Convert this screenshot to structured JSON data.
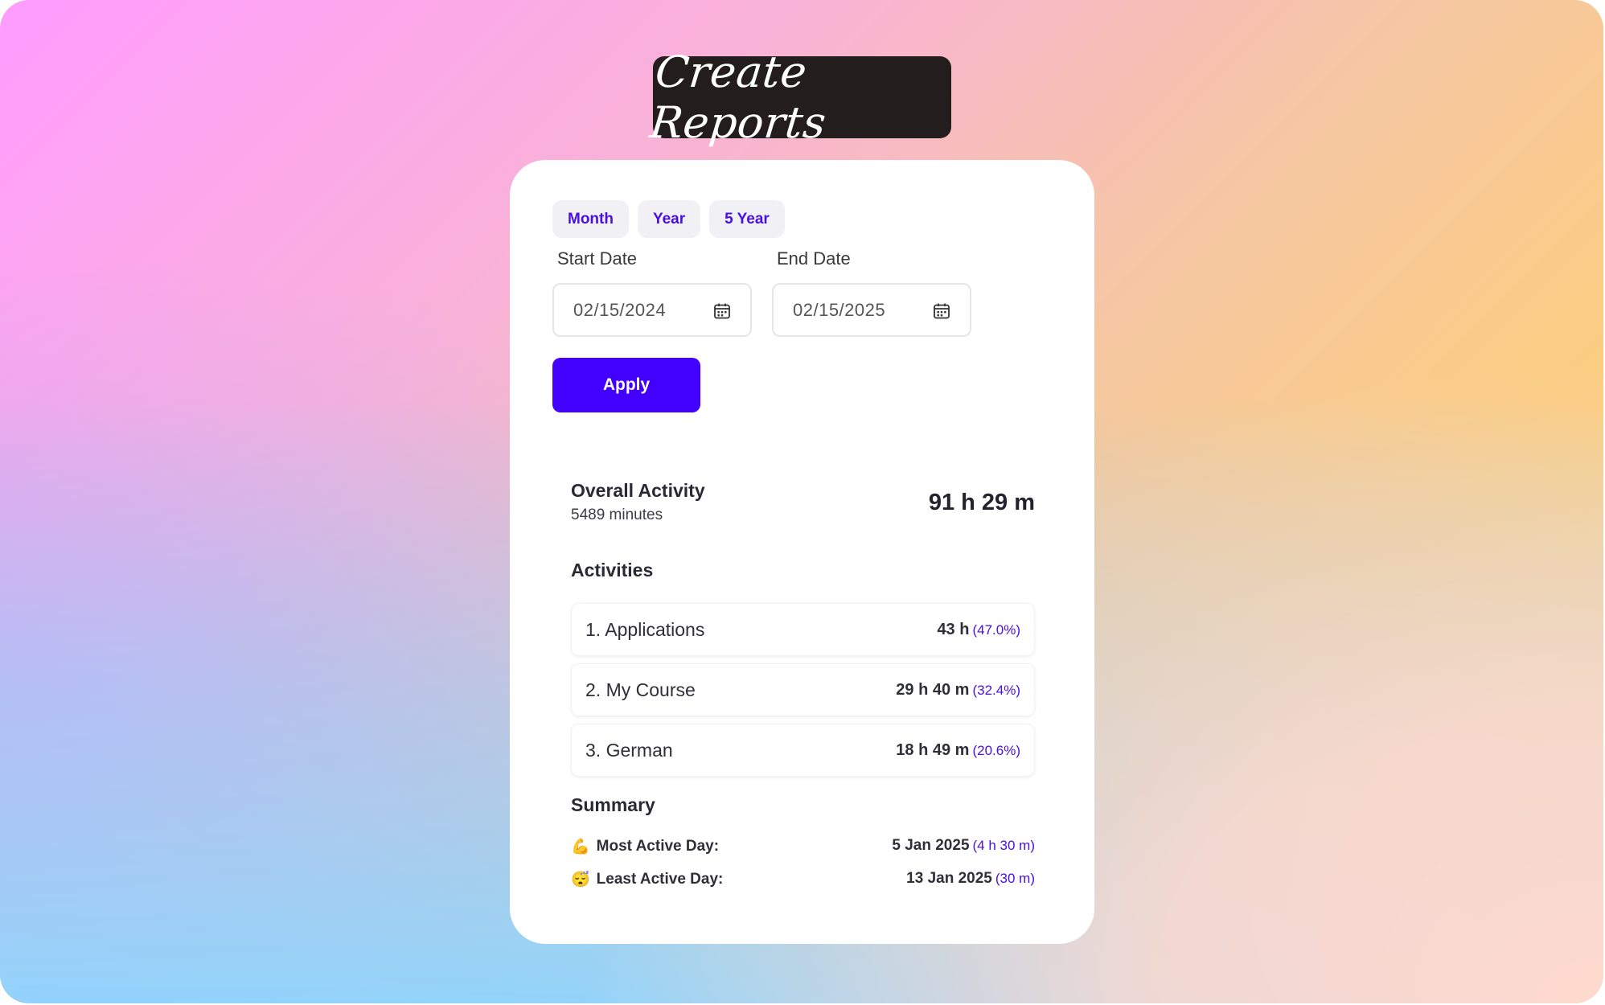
{
  "title": "Create Reports",
  "tabs": [
    {
      "label": "Month"
    },
    {
      "label": "Year"
    },
    {
      "label": "5 Year"
    }
  ],
  "start_date": {
    "label": "Start Date",
    "value": "02/15/2024"
  },
  "end_date": {
    "label": "End Date",
    "value": "02/15/2025"
  },
  "apply_label": "Apply",
  "overall": {
    "title": "Overall Activity",
    "minutes": "5489 minutes",
    "total": "91 h 29 m"
  },
  "activities": {
    "title": "Activities",
    "items": [
      {
        "name": "1. Applications",
        "time": "43 h",
        "pct": "(47.0%)"
      },
      {
        "name": "2. My Course",
        "time": "29 h 40 m",
        "pct": "(32.4%)"
      },
      {
        "name": "3. German",
        "time": "18 h 49 m",
        "pct": "(20.6%)"
      }
    ]
  },
  "summary": {
    "title": "Summary",
    "most": {
      "icon": "flexed-biceps-icon",
      "label": "Most Active Day:",
      "date": "5 Jan 2025",
      "duration": "(4 h 30 m)"
    },
    "least": {
      "icon": "sleeping-face-icon",
      "label": "Least Active Day:",
      "date": "13 Jan 2025",
      "duration": "(30 m)"
    }
  },
  "colors": {
    "accent": "#4200ff",
    "accent_text": "#4a10e0",
    "title_bg": "#241d1e"
  }
}
